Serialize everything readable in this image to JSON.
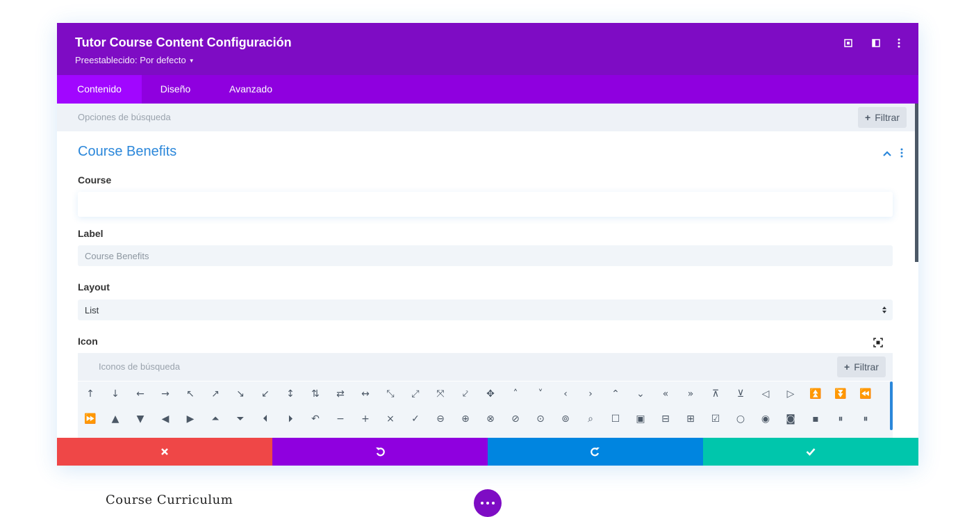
{
  "modal": {
    "title": "Tutor Course Content Configuración",
    "preset_label": "Preestablecido: Por defecto",
    "header_icons": [
      "focus-mode-icon",
      "split-view-icon",
      "more-options-icon"
    ]
  },
  "tabs": [
    {
      "label": "Contenido",
      "active": true
    },
    {
      "label": "Diseño",
      "active": false
    },
    {
      "label": "Avanzado",
      "active": false
    }
  ],
  "search": {
    "placeholder": "Opciones de búsqueda",
    "filter_label": "Filtrar"
  },
  "section": {
    "title": "Course Benefits"
  },
  "fields": {
    "course_label": "Course",
    "course_value": "",
    "label_label": "Label",
    "label_value": "Course Benefits",
    "layout_label": "Layout",
    "layout_value": "List",
    "icon_label": "Icon"
  },
  "icon_picker": {
    "placeholder": "Iconos de búsqueda",
    "filter_label": "Filtrar",
    "rows": [
      [
        "↑",
        "↓",
        "←",
        "→",
        "↖",
        "↗",
        "↘",
        "↙",
        "↕",
        "⇅",
        "⇄",
        "↔",
        "⤡",
        "⤢",
        "⤧",
        "⤦",
        "✥",
        "˄",
        "˅",
        "‹",
        "›",
        "⌃",
        "⌄",
        "«",
        "»",
        "⊼",
        "⊻",
        "◁",
        "▷",
        "⏫",
        "⏬",
        "⏪"
      ],
      [
        "⏩",
        "▲",
        "▼",
        "◀",
        "▶",
        "⏶",
        "⏷",
        "⏴",
        "⏵",
        "↶",
        "−",
        "+",
        "×",
        "✓",
        "⊖",
        "⊕",
        "⊗",
        "⊘",
        "⊙",
        "⊚",
        "⌕",
        "☐",
        "▣",
        "⊟",
        "⊞",
        "☑",
        "○",
        "◉",
        "◙",
        "▪",
        "⏸",
        "⏸"
      ]
    ]
  },
  "footer": {
    "buttons": [
      {
        "name": "discard-button",
        "icon": "close-icon",
        "color": "#ef4747"
      },
      {
        "name": "undo-button",
        "icon": "undo-icon",
        "color": "#8f00df"
      },
      {
        "name": "redo-button",
        "icon": "redo-icon",
        "color": "#0085e0"
      },
      {
        "name": "save-button",
        "icon": "check-icon",
        "color": "#00c6ac"
      }
    ]
  },
  "background": {
    "heading": "Course Curriculum"
  },
  "colors": {
    "header": "#7e0cc4",
    "tabs": "#8f00df",
    "active_tab": "#a106ff",
    "accent": "#2b87da"
  }
}
